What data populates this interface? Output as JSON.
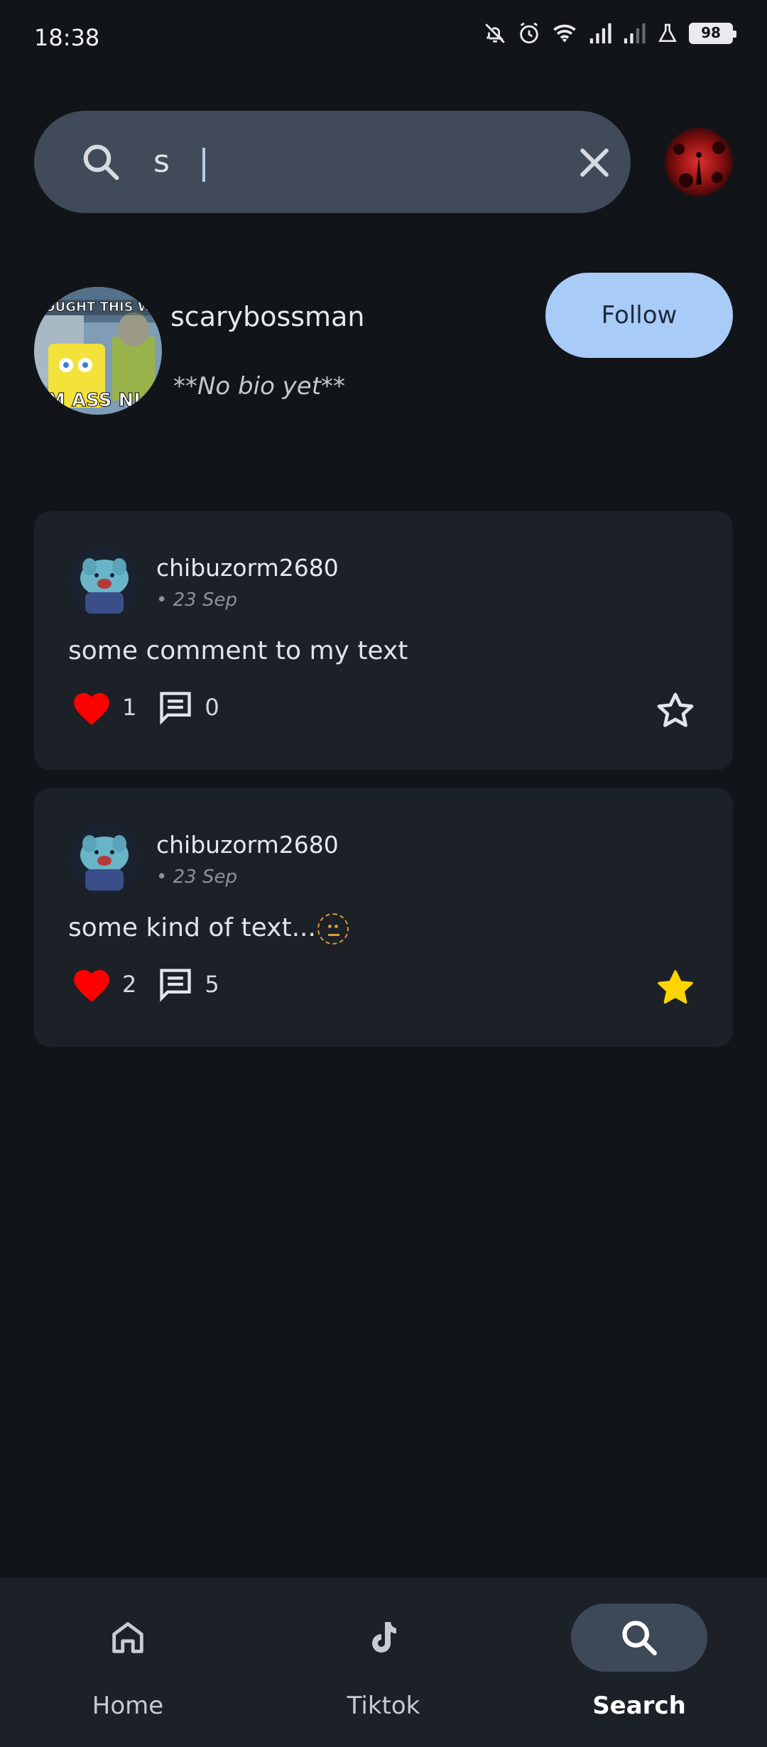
{
  "status_bar": {
    "time": "18:38",
    "battery": "98",
    "icons": [
      "bell-off-icon",
      "alarm-icon",
      "wifi-icon",
      "signal-icon",
      "signal-icon",
      "lab-flask-icon",
      "battery-icon"
    ]
  },
  "search": {
    "value": "s",
    "placeholder": ""
  },
  "profile_result": {
    "username": "scarybossman",
    "bio": "**No bio yet**",
    "follow_label": "Follow",
    "follow_color": "#a9cbf7"
  },
  "posts": [
    {
      "username": "chibuzorm2680",
      "date": "• 23 Sep",
      "text": "some comment to my text",
      "likes": "1",
      "comments": "0",
      "starred": false
    },
    {
      "username": "chibuzorm2680",
      "date": "• 23 Sep",
      "text": "some kind of text...",
      "likes": "2",
      "comments": "5",
      "starred": true
    }
  ],
  "nav": [
    {
      "label": "Home",
      "icon": "home-icon",
      "active": false
    },
    {
      "label": "Tiktok",
      "icon": "tiktok-icon",
      "active": false
    },
    {
      "label": "Search",
      "icon": "search-icon",
      "active": true
    }
  ],
  "colors": {
    "background": "#11151a",
    "card": "#1c2027",
    "heart": "#ff0000",
    "star_filled": "#ffd400"
  }
}
